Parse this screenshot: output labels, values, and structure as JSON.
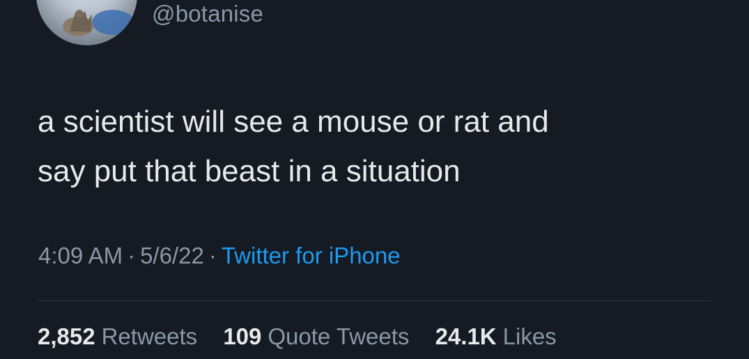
{
  "profile": {
    "handle": "@botanise",
    "avatar_icon": "avatar-photo"
  },
  "tweet": {
    "text_lines": [
      "a scientist will see a mouse or rat and",
      "say put that beast in a situation"
    ],
    "time": "4:09 AM",
    "separator": "·",
    "date": "5/6/22",
    "source": "Twitter for iPhone"
  },
  "stats": {
    "retweets_count": "2,852",
    "retweets_label": "Retweets",
    "quotes_count": "109",
    "quotes_label": "Quote Tweets",
    "likes_count": "24.1K",
    "likes_label": "Likes"
  },
  "colors": {
    "background": "#151a23",
    "text": "#e7e9ea",
    "muted": "#8b98a5",
    "link": "#1d9bf0",
    "divider": "#2f3640"
  }
}
